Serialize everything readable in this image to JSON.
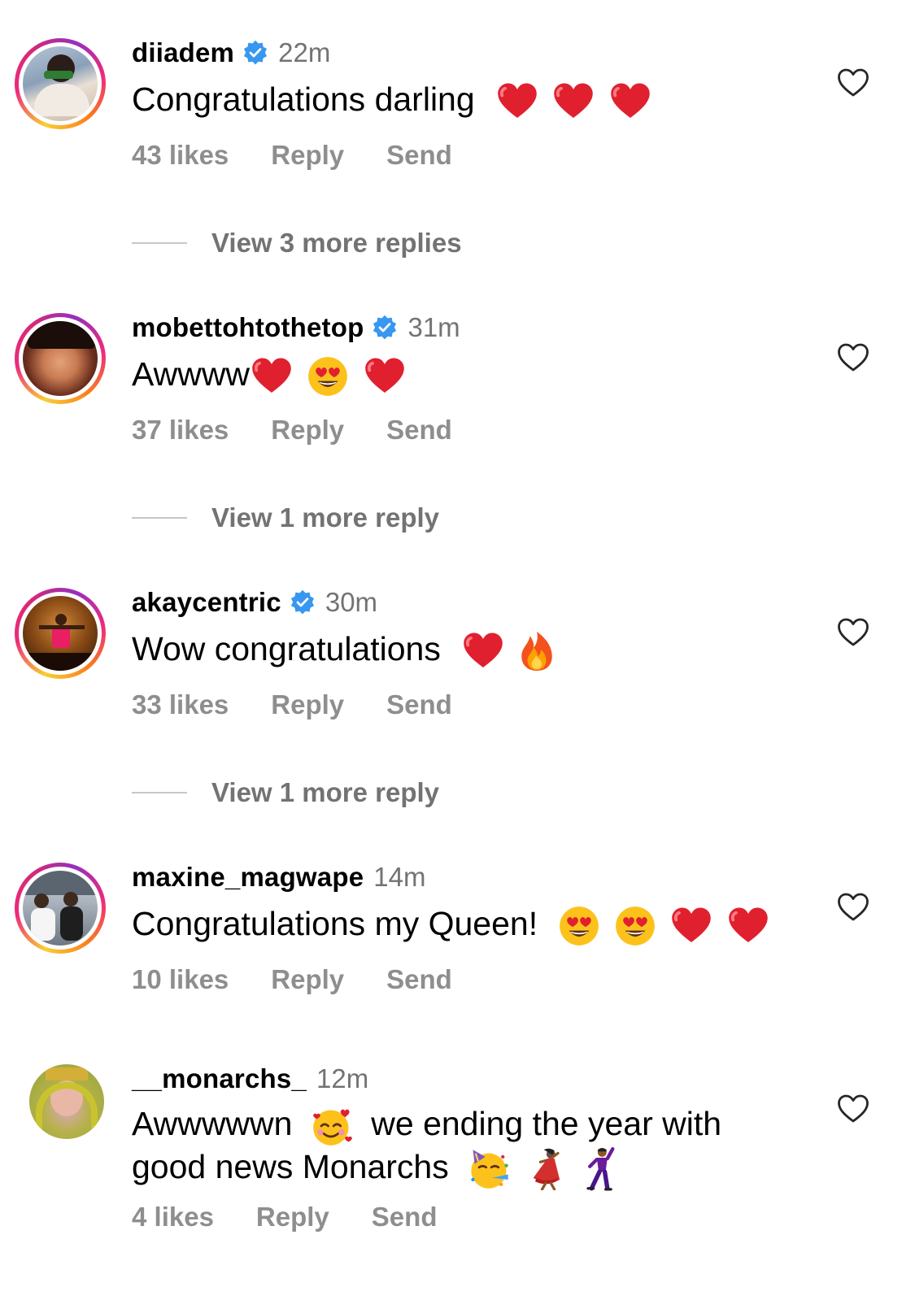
{
  "comments": [
    {
      "username": "diiadem",
      "verified": true,
      "time": "22m",
      "text": "Congratulations darling",
      "emojis": [
        "heart-emoji",
        "heart-emoji",
        "heart-emoji"
      ],
      "likes": "43 likes",
      "reply": "Reply",
      "send": "Send",
      "view_replies": "View 3 more replies"
    },
    {
      "username": "mobettohtothetop",
      "verified": true,
      "time": "31m",
      "text": "Awwww",
      "emojis": [
        "heart-emoji",
        "heart-eyes-emoji",
        "heart-emoji"
      ],
      "likes": "37 likes",
      "reply": "Reply",
      "send": "Send",
      "view_replies": "View 1 more reply"
    },
    {
      "username": "akaycentric",
      "verified": true,
      "time": "30m",
      "text": "Wow congratulations",
      "emojis": [
        "heart-emoji",
        "fire-emoji"
      ],
      "likes": "33 likes",
      "reply": "Reply",
      "send": "Send",
      "view_replies": "View 1 more reply"
    },
    {
      "username": "maxine_magwape",
      "verified": false,
      "time": "14m",
      "text": "Congratulations my Queen!",
      "emojis": [
        "heart-eyes-emoji",
        "heart-eyes-emoji",
        "heart-emoji",
        "heart-emoji"
      ],
      "likes": "10 likes",
      "reply": "Reply",
      "send": "Send"
    },
    {
      "username": "__monarchs_",
      "verified": false,
      "time": "12m",
      "text_line1_a": "Awwwwwn",
      "text_line1_b": "we ending the year with",
      "text_line2": "good news Monarchs",
      "emojis": [
        "smiling-hearts-emoji",
        "party-face-emoji",
        "dancer-emoji",
        "man-dancing-emoji"
      ],
      "likes": "4 likes",
      "reply": "Reply",
      "send": "Send"
    }
  ],
  "colors": {
    "verified_blue": "#3897f0",
    "secondary_text": "#737373",
    "meta_text": "#8e8e8e",
    "heart_red": "#e0202f"
  }
}
